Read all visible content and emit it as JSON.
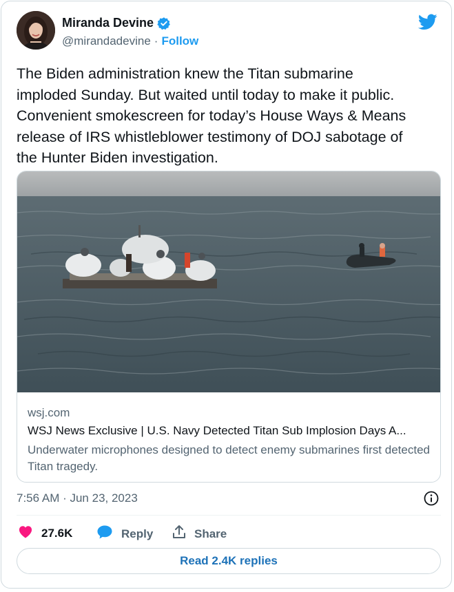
{
  "author": {
    "name": "Miranda Devine",
    "handle": "@mirandadevine",
    "separator": "·",
    "follow_label": "Follow",
    "verified": true
  },
  "tweet": {
    "text": "The Biden administration knew the Titan submarine\nimploded Sunday. But waited until today to make it public.\nConvenient smokescreen for today’s House Ways & Means\nrelease of IRS whistleblower testimony of DOJ sabotage of\nthe Hunter Biden investigation."
  },
  "link_card": {
    "domain": "wsj.com",
    "title": "WSJ News Exclusive | U.S. Navy Detected Titan Sub Implosion Days A...",
    "description": "Underwater microphones designed to detect enemy submarines first detected Titan tragedy."
  },
  "meta": {
    "timestamp": "7:56 AM · Jun 23, 2023"
  },
  "actions": {
    "likes": "27.6K",
    "reply_label": "Reply",
    "share_label": "Share",
    "read_replies_label": "Read 2.4K replies"
  },
  "colors": {
    "accent": "#1d9bf0",
    "like": "#f91880",
    "text_secondary": "#536471",
    "border": "#cfd9de"
  },
  "icons": [
    "verified-badge-icon",
    "twitter-bird-icon",
    "info-icon",
    "heart-icon",
    "reply-bubble-icon",
    "share-icon"
  ]
}
